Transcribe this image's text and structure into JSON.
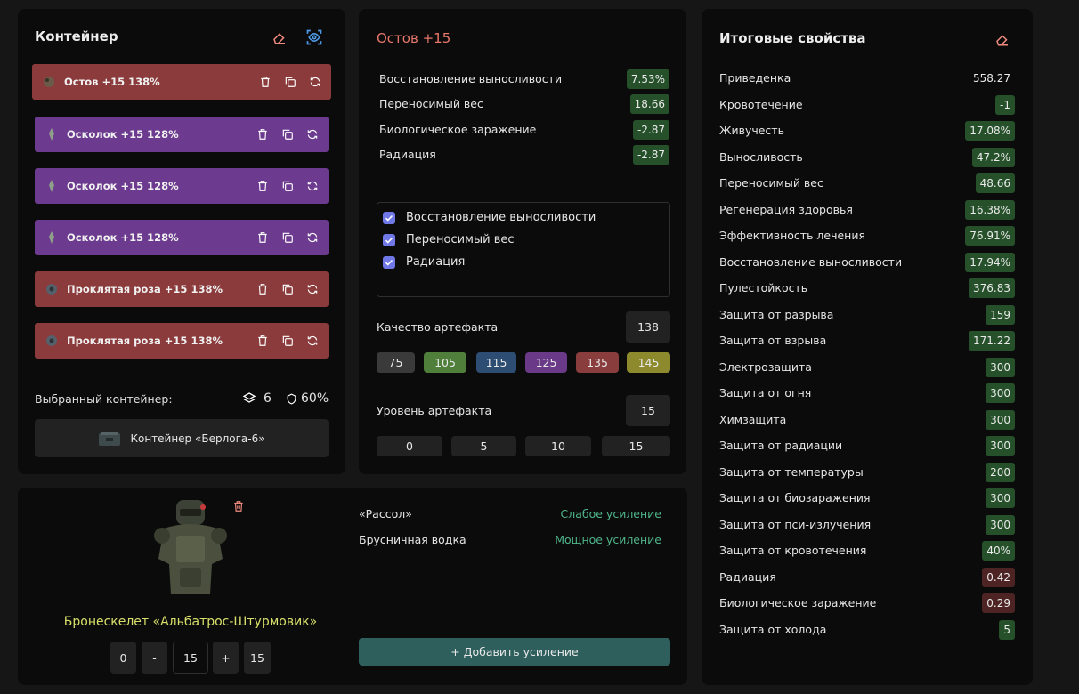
{
  "container_panel": {
    "title": "Контейнер",
    "artifacts": [
      {
        "name": "Остов",
        "level": "+15",
        "quality": "138%",
        "color": "#8b3b3b"
      },
      {
        "name": "Осколок",
        "level": "+15",
        "quality": "128%",
        "color": "#6c3b8f"
      },
      {
        "name": "Осколок",
        "level": "+15",
        "quality": "128%",
        "color": "#6c3b8f"
      },
      {
        "name": "Осколок",
        "level": "+15",
        "quality": "128%",
        "color": "#6c3b8f"
      },
      {
        "name": "Проклятая роза",
        "level": "+15",
        "quality": "138%",
        "color": "#8b3b3b"
      },
      {
        "name": "Проклятая роза",
        "level": "+15",
        "quality": "138%",
        "color": "#8b3b3b"
      }
    ],
    "selected_label": "Выбранный контейнер:",
    "slots": "6",
    "protection": "60%",
    "container_name": "Контейнер «Берлога-6»"
  },
  "artifact_panel": {
    "title": "Остов +15",
    "stats": [
      {
        "label": "Восстановление выносливости",
        "value": "7.53%"
      },
      {
        "label": "Переносимый вес",
        "value": "18.66"
      },
      {
        "label": "Биологическое заражение",
        "value": "-2.87"
      },
      {
        "label": "Радиация",
        "value": "-2.87"
      }
    ],
    "checks": [
      "Восстановление выносливости",
      "Переносимый вес",
      "Радиация"
    ],
    "quality_label": "Качество артефакта",
    "quality_value": "138",
    "quality_presets": [
      "75",
      "105",
      "115",
      "125",
      "135",
      "145"
    ],
    "level_label": "Уровень артефакта",
    "level_value": "15",
    "level_presets": [
      "0",
      "5",
      "10",
      "15"
    ]
  },
  "armor_panel": {
    "name": "Бронескелет «Альбатрос-Штурмовик»",
    "upgrade_min": "0",
    "minus": "-",
    "upgrade_value": "15",
    "plus": "+",
    "upgrade_max": "15",
    "boosts": [
      {
        "name": "«Рассол»",
        "effect": "Слабое усиление"
      },
      {
        "name": "Брусничная водка",
        "effect": "Мощное усиление"
      }
    ],
    "add_boost_label": "+ Добавить усиление"
  },
  "totals_panel": {
    "title": "Итоговые свойства",
    "rows": [
      {
        "label": "Приведенка",
        "value": "558.27",
        "tone": "plain"
      },
      {
        "label": "Кровотечение",
        "value": "-1",
        "tone": "g"
      },
      {
        "label": "Живучесть",
        "value": "17.08%",
        "tone": "g"
      },
      {
        "label": "Выносливость",
        "value": "47.2%",
        "tone": "g"
      },
      {
        "label": "Переносимый вес",
        "value": "48.66",
        "tone": "g"
      },
      {
        "label": "Регенерация здоровья",
        "value": "16.38%",
        "tone": "g"
      },
      {
        "label": "Эффективность лечения",
        "value": "76.91%",
        "tone": "g"
      },
      {
        "label": "Восстановление выносливости",
        "value": "17.94%",
        "tone": "g"
      },
      {
        "label": "Пулестойкость",
        "value": "376.83",
        "tone": "g"
      },
      {
        "label": "Защита от разрыва",
        "value": "159",
        "tone": "g"
      },
      {
        "label": "Защита от взрыва",
        "value": "171.22",
        "tone": "g"
      },
      {
        "label": "Электрозащита",
        "value": "300",
        "tone": "g"
      },
      {
        "label": "Защита от огня",
        "value": "300",
        "tone": "g"
      },
      {
        "label": "Химзащита",
        "value": "300",
        "tone": "g"
      },
      {
        "label": "Защита от радиации",
        "value": "300",
        "tone": "g"
      },
      {
        "label": "Защита от температуры",
        "value": "200",
        "tone": "g"
      },
      {
        "label": "Защита от биозаражения",
        "value": "300",
        "tone": "g"
      },
      {
        "label": "Защита от пси-излучения",
        "value": "300",
        "tone": "g"
      },
      {
        "label": "Защита от кровотечения",
        "value": "40%",
        "tone": "g"
      },
      {
        "label": "Радиация",
        "value": "0.42",
        "tone": "r"
      },
      {
        "label": "Биологическое заражение",
        "value": "0.29",
        "tone": "r"
      },
      {
        "label": "Защита от холода",
        "value": "5",
        "tone": "g"
      }
    ]
  },
  "colors": {
    "title_red": "#e8776b",
    "armor_name": "#d9e06a",
    "boost_green": "#4fb58a",
    "add_button": "#2f5f5c",
    "preset_75": "#3a3a3a",
    "preset_105": "#4f7f3a",
    "preset_115": "#2e4d73",
    "preset_125": "#6a3a88",
    "preset_135": "#8a3d3d",
    "preset_145": "#8d8a2e"
  }
}
